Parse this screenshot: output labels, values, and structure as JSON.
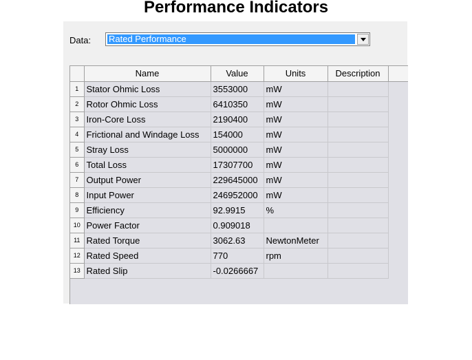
{
  "page": {
    "title": "Performance Indicators"
  },
  "selector": {
    "label": "Data:",
    "value": "Rated Performance"
  },
  "table": {
    "columns": [
      "Name",
      "Value",
      "Units",
      "Description"
    ],
    "rows": [
      {
        "num": "1",
        "name": "Stator Ohmic Loss",
        "value": "3553000",
        "units": "mW",
        "description": ""
      },
      {
        "num": "2",
        "name": "Rotor Ohmic Loss",
        "value": "6410350",
        "units": "mW",
        "description": ""
      },
      {
        "num": "3",
        "name": "Iron-Core Loss",
        "value": "2190400",
        "units": "mW",
        "description": ""
      },
      {
        "num": "4",
        "name": "Frictional and Windage Loss",
        "value": "154000",
        "units": "mW",
        "description": ""
      },
      {
        "num": "5",
        "name": "Stray Loss",
        "value": "5000000",
        "units": "mW",
        "description": ""
      },
      {
        "num": "6",
        "name": "Total Loss",
        "value": "17307700",
        "units": "mW",
        "description": ""
      },
      {
        "num": "7",
        "name": "Output Power",
        "value": "229645000",
        "units": "mW",
        "description": ""
      },
      {
        "num": "8",
        "name": "Input Power",
        "value": "246952000",
        "units": "mW",
        "description": ""
      },
      {
        "num": "9",
        "name": "Efficiency",
        "value": "92.9915",
        "units": "%",
        "description": ""
      },
      {
        "num": "10",
        "name": "Power Factor",
        "value": "0.909018",
        "units": "",
        "description": ""
      },
      {
        "num": "11",
        "name": "Rated Torque",
        "value": "3062.63",
        "units": "NewtonMeter",
        "description": ""
      },
      {
        "num": "12",
        "name": "Rated Speed",
        "value": "770",
        "units": "rpm",
        "description": ""
      },
      {
        "num": "13",
        "name": "Rated Slip",
        "value": "-0.0266667",
        "units": "",
        "description": ""
      }
    ]
  },
  "colors": {
    "selection": "#3399ff",
    "panel": "#f0f0f0",
    "grid": "#e0e0e6"
  },
  "icons": {
    "dropdown": "chevron-down-icon"
  }
}
